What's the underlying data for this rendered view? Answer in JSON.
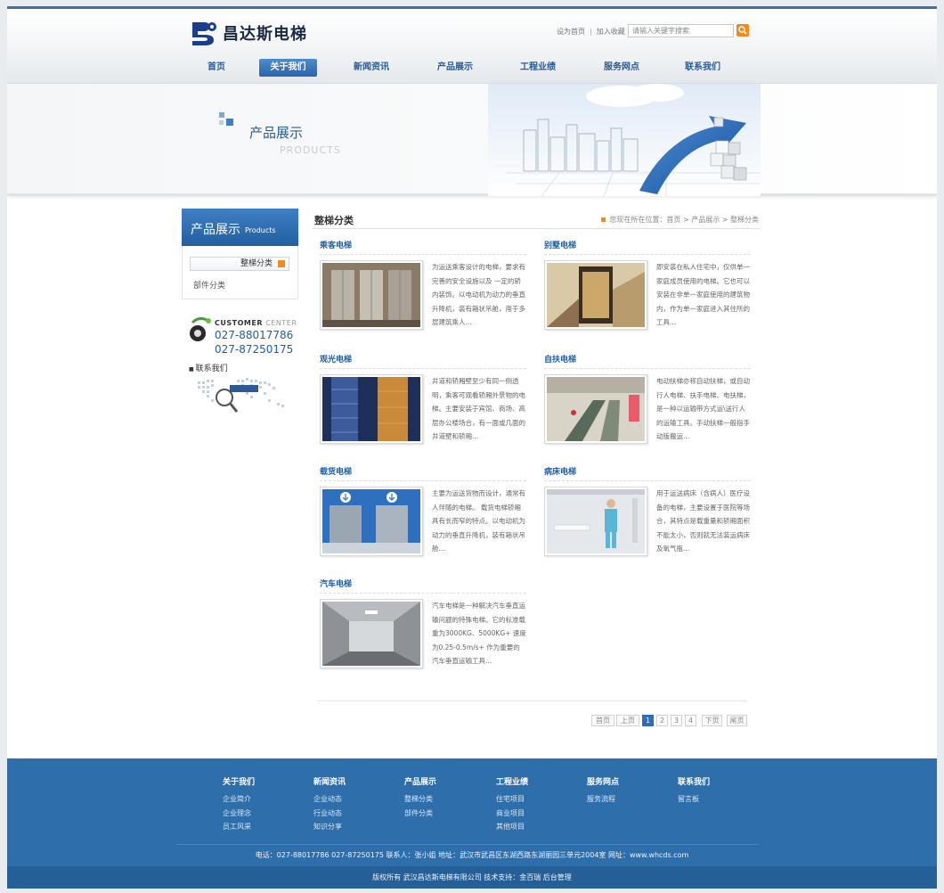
{
  "brand": {
    "name": "昌达斯电梯",
    "accent": "#2b5a94",
    "footer_blue": "#2d6eab",
    "orange": "#f08a1c"
  },
  "header": {
    "set_home": "设为首页",
    "separator": "|",
    "bookmark": "加入收藏",
    "search_placeholder": "请输入关键字搜索",
    "search_icon": "search-icon"
  },
  "nav": [
    {
      "label": "首页",
      "active": false
    },
    {
      "label": "关于我们",
      "active": true
    },
    {
      "label": "新闻资讯",
      "active": false
    },
    {
      "label": "产品展示",
      "active": false
    },
    {
      "label": "工程业绩",
      "active": false
    },
    {
      "label": "服务网点",
      "active": false
    },
    {
      "label": "联系我们",
      "active": false
    }
  ],
  "banner": {
    "title": "产品展示",
    "subtitle": "PRODUCTS"
  },
  "sidebar": {
    "title": "产品展示",
    "title_en": "Products",
    "items": [
      {
        "label": "整梯分类",
        "active": true
      },
      {
        "label": "部件分类",
        "active": false
      }
    ],
    "customer_center": {
      "title": "CUSTOMER",
      "title2": "CENTER",
      "phones": [
        "027-88017786",
        "027-87250175"
      ]
    },
    "contact_label": "联系我们"
  },
  "main": {
    "title": "整梯分类",
    "breadcrumb": "您现在所在位置：首页 > 产品展示 > 整梯分类",
    "products": [
      {
        "name": "乘客电梯",
        "desc": "为运送乘客设计的电梯，要求有完善的安全设施以及 一定的轿内装饰。以电动机为动力的垂直升降机，装有箱状吊舱，用于多层建筑乘人..."
      },
      {
        "name": "别墅电梯",
        "desc": "即安装在私人住宅中，仅供单一家庭成员使用的电梯。它也可以安装在非单一家庭使用的建筑物内，作为单一家庭进入其住所的工具..."
      },
      {
        "name": "观光电梯",
        "desc": "井道和轿厢壁至少有同一侧透明，乘客可观看轿厢外景物的电梯。主要安装于宾馆、商场、高层办公楼场合，有一面或几面的井道壁和轿厢..."
      },
      {
        "name": "自扶电梯",
        "desc": "电动扶梯亦称自动扶梯，或自动行人电梯、扶手电梯、电扶梯，是一种以运输带方式运\\送行人的运输工具。手动扶梯一般指手动版搬运..."
      },
      {
        "name": "载货电梯",
        "desc": "主要为运送货物而设计，通常有人伴随的电梯。 载货电梯轿厢具有长而窄的特点。以电动机为动力的垂直升降机，装有箱状吊舱..."
      },
      {
        "name": "病床电梯",
        "desc": "用于运送病床（含病人）医疗设备的电梯，主要设置于医院等场合，其特点是载重量和轿厢面积不能太小，否则就无法装运病床及氧气瓶..."
      },
      {
        "name": "汽车电梯",
        "desc": "汽车电梯是一种解决汽车垂直运输问题的特殊电梯。它的标准载重为3000KG、5000KG+ 速度为0.25-0.5m/s+ 作为重要的汽车垂直运输工具..."
      }
    ],
    "pagination": [
      "首页",
      "上页",
      "1",
      "2",
      "3",
      "4",
      "下页",
      "尾页"
    ],
    "current_page": "1"
  },
  "footer": {
    "columns": [
      {
        "title": "关于我们",
        "items": [
          "企业简介",
          "企业理念",
          "员工风采"
        ]
      },
      {
        "title": "新闻资讯",
        "items": [
          "企业动态",
          "行业动态",
          "知识分享"
        ]
      },
      {
        "title": "产品展示",
        "items": [
          "整梯分类",
          "部件分类"
        ]
      },
      {
        "title": "工程业绩",
        "items": [
          "住宅项目",
          "商业项目",
          "其他项目"
        ]
      },
      {
        "title": "服务网点",
        "items": [
          "服务流程"
        ]
      },
      {
        "title": "联系我们",
        "items": [
          "留言板"
        ]
      }
    ],
    "contact_line": "电话：027-88017786 027-87250175 联系人：张小姐 地址：武汉市武昌区东湖西路东湖丽园三单元2004室 网址：www.whcds.com",
    "copyright_line": "版权所有 武汉昌达斯电梯有限公司 技术支持：金百瑞 后台管理"
  }
}
